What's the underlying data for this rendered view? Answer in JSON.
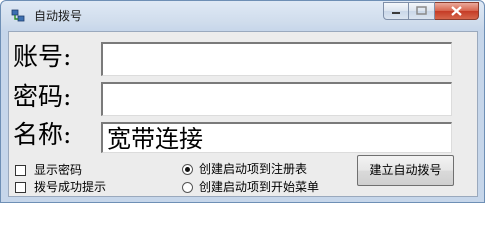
{
  "window": {
    "title": "自动拨号",
    "icon": "network-connection-icon",
    "caption_buttons": [
      "minimize-icon",
      "maximize-icon",
      "close-icon"
    ]
  },
  "form": {
    "account_label": "账号:",
    "account_value": "",
    "password_label": "密码:",
    "password_value": "",
    "name_label": "名称:",
    "name_value": "宽带连接"
  },
  "options": {
    "show_password": {
      "label": "显示密码",
      "checked": false
    },
    "dial_success_prompt": {
      "label": "拨号成功提示",
      "checked": false
    },
    "create_to_registry": {
      "label": "创建启动项到注册表",
      "selected": true
    },
    "create_to_startmenu": {
      "label": "创建启动项到开始菜单",
      "selected": false
    }
  },
  "actions": {
    "create_button": "建立自动拨号"
  }
}
